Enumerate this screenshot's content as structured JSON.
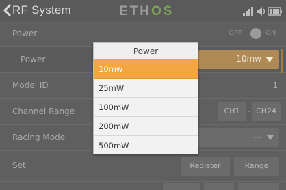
{
  "header": {
    "title": "RF System",
    "logo_left": "ETH",
    "logo_right": "OS",
    "back_icon": "chevron-left-icon",
    "status_icons": [
      "signal-icon",
      "volume-icon",
      "battery-icon"
    ]
  },
  "rows": {
    "power": {
      "label": "Power",
      "off_label": "OFF",
      "on_label": "ON"
    },
    "power_sub": {
      "label": "Power",
      "value": "10mw"
    },
    "model_id": {
      "label": "Model ID",
      "value": "1"
    },
    "channel_range": {
      "label": "Channel Range",
      "start": "CH1",
      "separator": "-",
      "end": "CH24"
    },
    "racing_mode": {
      "label": "Racing Mode",
      "value": "---"
    },
    "set": {
      "label": "Set",
      "register_label": "Register",
      "range_label": "Range"
    }
  },
  "popup": {
    "title": "Power",
    "items": [
      "10mw",
      "25mW",
      "100mW",
      "200mW",
      "500mW"
    ],
    "selected_index": 0
  },
  "colors": {
    "accent": "#f5a542",
    "select_bg": "#b08a55",
    "logo_accent": "#7da35a"
  }
}
